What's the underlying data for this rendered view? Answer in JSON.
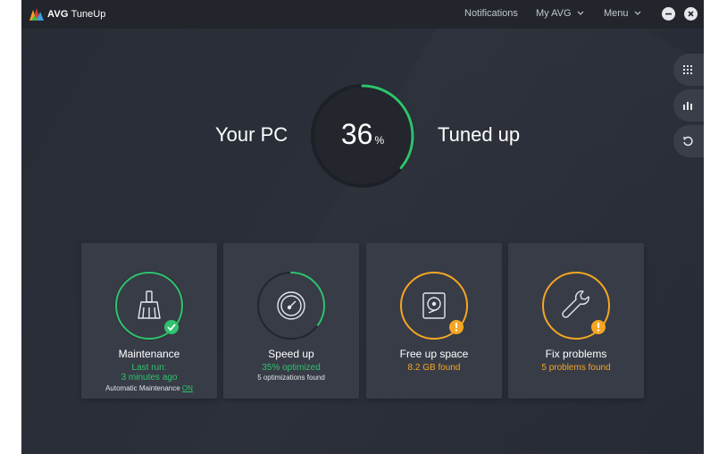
{
  "app": {
    "brand": "AVG",
    "product": "TuneUp"
  },
  "topnav": {
    "notifications": "Notifications",
    "my_avg": "My AVG",
    "menu": "Menu"
  },
  "hero": {
    "left_label": "Your PC",
    "right_label": "Tuned up",
    "percent": "36",
    "percent_unit": "%",
    "percent_value": 36
  },
  "cards": [
    {
      "title": "Maintenance",
      "line1": "Last run:",
      "line2": "3 minutes ago",
      "footer_prefix": "Automatic Maintenance",
      "footer_toggle": "ON",
      "status": "ok",
      "ring_color": "#2fc36e",
      "ring_progress": 1.0
    },
    {
      "title": "Speed up",
      "line1": "35% optimized",
      "line2": "5 optimizations found",
      "status": "progress",
      "ring_color": "#2fc36e",
      "ring_progress": 0.35
    },
    {
      "title": "Free up space",
      "line1": "8.2 GB found",
      "status": "warning",
      "ring_color": "#f5a623",
      "ring_progress": 1.0
    },
    {
      "title": "Fix problems",
      "line1": "5 problems found",
      "status": "warning",
      "ring_color": "#f5a623",
      "ring_progress": 1.0
    }
  ],
  "side_buttons": [
    "grid-icon",
    "stats-icon",
    "history-icon"
  ],
  "colors": {
    "accent_green": "#2fc36e",
    "accent_orange": "#f5a623",
    "card_bg": "#383c47",
    "window_bg": "#2a2e37"
  }
}
